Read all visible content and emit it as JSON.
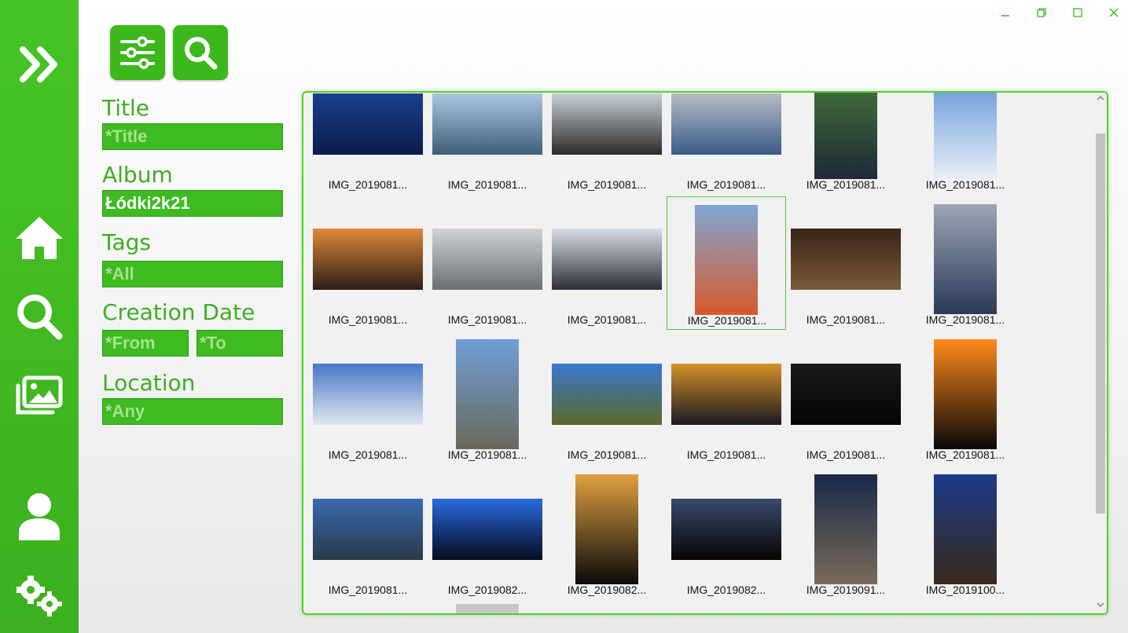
{
  "window": {
    "minimize_icon": "minimize-icon",
    "restore_icon": "restore-icon",
    "maximize_icon": "maximize-icon",
    "close_icon": "close-icon"
  },
  "sidebar": {
    "items": [
      {
        "name": "expand",
        "icon": "double-chevron-right-icon"
      },
      {
        "name": "home",
        "icon": "home-icon"
      },
      {
        "name": "search",
        "icon": "search-icon"
      },
      {
        "name": "gallery",
        "icon": "images-icon"
      },
      {
        "name": "user",
        "icon": "user-icon"
      },
      {
        "name": "settings",
        "icon": "gears-icon"
      }
    ]
  },
  "toolbar": {
    "filter_icon": "sliders-icon",
    "search_icon": "search-icon"
  },
  "filters": {
    "title": {
      "label": "Title",
      "placeholder": "*Title",
      "value": ""
    },
    "album": {
      "label": "Album",
      "value": "Łódki2k21"
    },
    "tags": {
      "label": "Tags",
      "placeholder": "*All",
      "value": ""
    },
    "creation_date": {
      "label": "Creation Date",
      "from_placeholder": "*From",
      "to_placeholder": "*To"
    },
    "location": {
      "label": "Location",
      "placeholder": "*Any",
      "value": ""
    }
  },
  "colors": {
    "accent": "#3cb81c",
    "selection": "#5cc23a"
  },
  "gallery": {
    "selected_index": 9,
    "photos": [
      {
        "caption": "IMG_2019081...",
        "orient": "land",
        "c1": "#1a3f8f",
        "c2": "#0b1c4a"
      },
      {
        "caption": "IMG_2019081...",
        "orient": "land",
        "c1": "#a9c6e0",
        "c2": "#3f5f78"
      },
      {
        "caption": "IMG_2019081...",
        "orient": "land",
        "c1": "#c8d0d8",
        "c2": "#2a2a2a"
      },
      {
        "caption": "IMG_2019081...",
        "orient": "land",
        "c1": "#b7bcc4",
        "c2": "#3a5a88"
      },
      {
        "caption": "IMG_2019081...",
        "orient": "port",
        "c1": "#4a7a3a",
        "c2": "#1e2a3a"
      },
      {
        "caption": "IMG_2019081...",
        "orient": "port",
        "c1": "#5a8fd8",
        "c2": "#e8eef6"
      },
      {
        "caption": "IMG_2019081...",
        "orient": "land",
        "c1": "#e08a3a",
        "c2": "#2a1e14"
      },
      {
        "caption": "IMG_2019081...",
        "orient": "land",
        "c1": "#cfd3d8",
        "c2": "#6a6f70"
      },
      {
        "caption": "IMG_2019081...",
        "orient": "land",
        "c1": "#d8dde6",
        "c2": "#2c2f38"
      },
      {
        "caption": "IMG_2019081...",
        "orient": "port",
        "c1": "#7ea6d4",
        "c2": "#d85a2a"
      },
      {
        "caption": "IMG_2019081...",
        "orient": "land",
        "c1": "#3a2418",
        "c2": "#7a5a3a"
      },
      {
        "caption": "IMG_2019081...",
        "orient": "port",
        "c1": "#9aa6b4",
        "c2": "#2a3a58"
      },
      {
        "caption": "IMG_2019081...",
        "orient": "land",
        "c1": "#4a78c8",
        "c2": "#dfe6ee"
      },
      {
        "caption": "IMG_2019081...",
        "orient": "port",
        "c1": "#6f9ed8",
        "c2": "#6a6a5a"
      },
      {
        "caption": "IMG_2019081...",
        "orient": "land",
        "c1": "#3a78d0",
        "c2": "#5a6a2a"
      },
      {
        "caption": "IMG_2019081...",
        "orient": "land",
        "c1": "#d4902a",
        "c2": "#1a1a22"
      },
      {
        "caption": "IMG_2019081...",
        "orient": "land",
        "c1": "#1a1a1a",
        "c2": "#050505"
      },
      {
        "caption": "IMG_2019081...",
        "orient": "port",
        "c1": "#ff8a1a",
        "c2": "#080808"
      },
      {
        "caption": "IMG_2019081...",
        "orient": "land",
        "c1": "#3a6ab0",
        "c2": "#2a3a4a"
      },
      {
        "caption": "IMG_2019082...",
        "orient": "land",
        "c1": "#2a6ae0",
        "c2": "#060c20"
      },
      {
        "caption": "IMG_2019082...",
        "orient": "port",
        "c1": "#e0a040",
        "c2": "#0a0a0a"
      },
      {
        "caption": "IMG_2019082...",
        "orient": "land",
        "c1": "#3a4a6a",
        "c2": "#050505"
      },
      {
        "caption": "IMG_2019091...",
        "orient": "port",
        "c1": "#1a2a4a",
        "c2": "#7a6a5a"
      },
      {
        "caption": "IMG_2019100...",
        "orient": "port",
        "c1": "#1a3a8a",
        "c2": "#3a2a1a"
      }
    ]
  }
}
